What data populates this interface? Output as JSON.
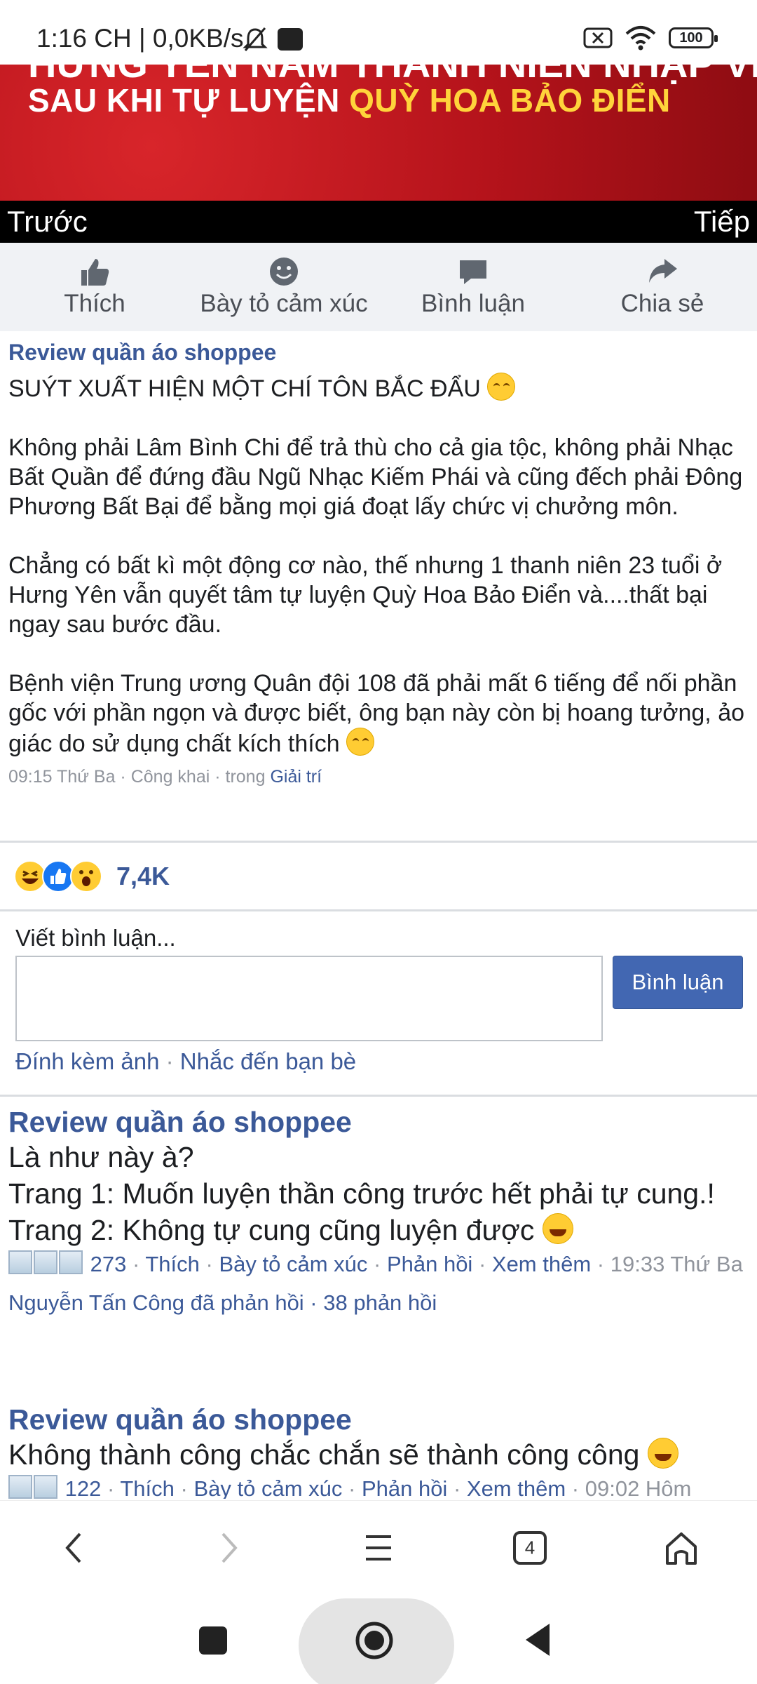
{
  "status_bar": {
    "time": "1:16 CH | 0,0KB/s",
    "battery": "100",
    "icons": [
      "mute-bell-icon",
      "notification-square-icon",
      "sim-off-icon",
      "wifi-icon",
      "battery-icon"
    ]
  },
  "banner": {
    "top_text": "HƯNG YÊN NAM THANH NIÊN NHẬP VIỆN",
    "headline_white": "SAU KHI TỰ LUYỆN ",
    "headline_yellow": "QUỲ HOA BẢO ĐIỂN",
    "prev": "Trước",
    "next": "Tiếp"
  },
  "actions": {
    "like": "Thích",
    "react": "Bày tỏ cảm xúc",
    "comment": "Bình luận",
    "share": "Chia sẻ"
  },
  "post": {
    "author": "Review quần áo shoppee",
    "title": "SUÝT XUẤT HIỆN MỘT CHÍ TÔN BẮC ĐẨU",
    "p1": "Không phải Lâm Bình Chi để trả thù cho cả gia tộc, không phải Nhạc Bất Quần để đứng đầu Ngũ Nhạc Kiếm Phái và cũng đếch phải Đông Phương Bất Bại để bằng mọi giá đoạt lấy chức vị chưởng môn.",
    "p2": "Chẳng có bất kì một động cơ nào, thế nhưng 1 thanh niên 23 tuổi ở Hưng Yên vẫn quyết tâm tự luyện Quỳ Hoa Bảo Điển và....thất bại ngay sau bước đầu.",
    "p3": "Bệnh viện Trung ương Quân đội 108 đã phải mất 6 tiếng để nối phần gốc với phần ngọn và được biết, ông bạn này còn bị hoang tưởng, ảo giác do sử dụng chất kích thích",
    "meta": "09:15 Thứ Ba · Công khai · trong ",
    "category": "Giải trí"
  },
  "reactions": {
    "count": "7,4K",
    "icons": [
      "haha-icon",
      "like-icon",
      "wow-icon"
    ]
  },
  "comment_box": {
    "label": "Viết bình luận...",
    "placeholder": "",
    "button": "Bình luận",
    "attach": "Đính kèm ảnh",
    "sep": " · ",
    "mention": "Nhắc đến bạn bè"
  },
  "comments": [
    {
      "author": "Review quần áo shoppee",
      "lines": [
        "Là như này à?",
        "Trang 1: Muốn luyện thần công trước hết phải tự cung.!",
        "Trang 2: Không tự cung cũng luyện được"
      ],
      "count": "273",
      "like": "Thích",
      "react": "Bày tỏ cảm xúc",
      "reply": "Phản hồi",
      "more": "Xem thêm",
      "time": "19:33 Thứ Ba",
      "replies": "Nguyễn Tấn Công đã phản hồi · 38 phản hồi"
    },
    {
      "author": "Review quần áo shoppee",
      "lines": [
        "Không thành công chắc chắn sẽ thành công công"
      ],
      "count": "122",
      "like": "Thích",
      "react": "Bày tỏ cảm xúc",
      "reply": "Phản hồi",
      "more": "Xem thêm",
      "time": "09:02 Hôm"
    }
  ],
  "browser_nav": {
    "tabs_count": "4",
    "icons": [
      "back-icon",
      "forward-icon",
      "menu-icon",
      "tabs-icon",
      "home-icon"
    ]
  },
  "system_nav": {
    "icons": [
      "recents-square-icon",
      "home-circle-icon",
      "back-triangle-icon"
    ]
  }
}
